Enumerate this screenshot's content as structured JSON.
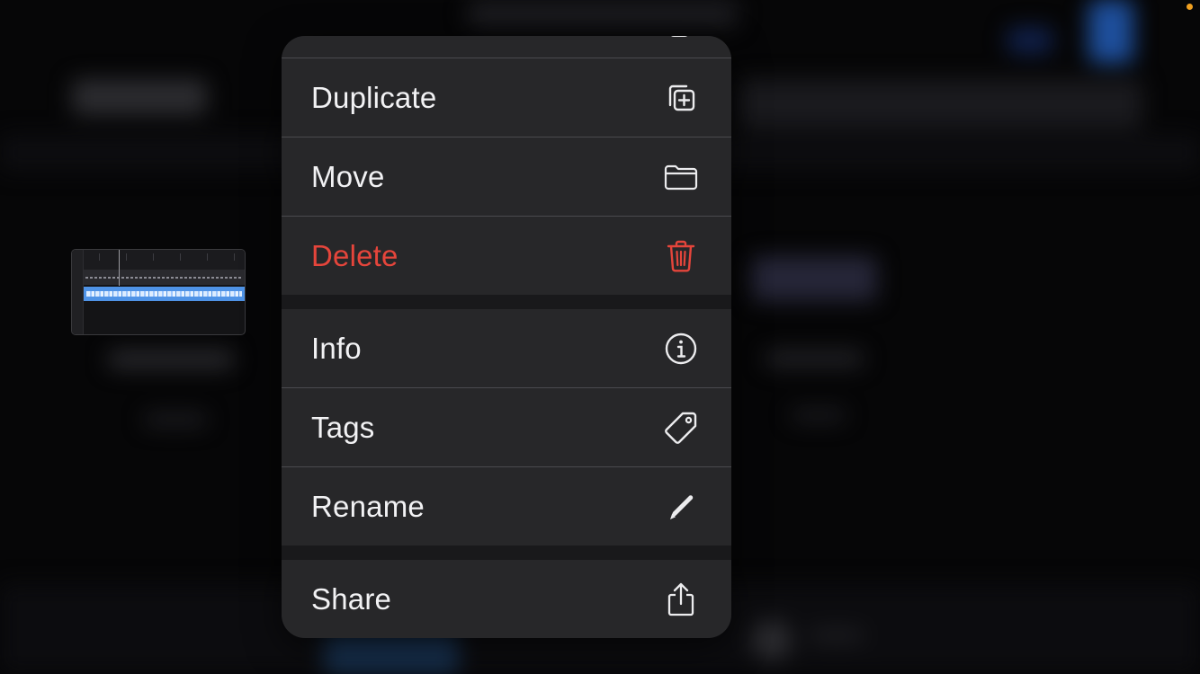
{
  "background": {
    "color": "#060607",
    "status_dot_color": "#f0a020"
  },
  "menu": {
    "background": "#272729",
    "label_color": "#f2f2f4",
    "destructive_color": "#e5453b",
    "items": [
      {
        "label": "Duplicate",
        "icon": "duplicate-plus-icon"
      },
      {
        "label": "Move",
        "icon": "folder-icon"
      },
      {
        "label": "Delete",
        "icon": "trash-icon",
        "destructive": true
      },
      {
        "label": "Info",
        "icon": "info-circle-icon"
      },
      {
        "label": "Tags",
        "icon": "tag-icon"
      },
      {
        "label": "Rename",
        "icon": "pencil-icon"
      },
      {
        "label": "Share",
        "icon": "share-icon"
      }
    ]
  },
  "thumbnail": {
    "region_color": "#4f93e6"
  }
}
